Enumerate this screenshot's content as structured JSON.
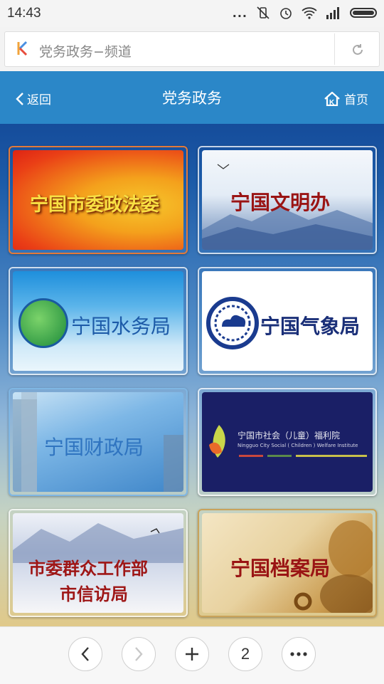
{
  "status_bar": {
    "time": "14:43",
    "dots": "..."
  },
  "address_bar": {
    "title": "党务政务−频道"
  },
  "header": {
    "back_label": "返回",
    "title": "党务政务",
    "home_label": "首页"
  },
  "tiles": [
    {
      "label": "宁国市委政法委"
    },
    {
      "label": "宁国文明办"
    },
    {
      "label": "宁国水务局"
    },
    {
      "label": "宁国气象局"
    },
    {
      "label": "宁国财政局"
    },
    {
      "label": "宁国市社会（儿童）福利院",
      "sub": "Ningguo City Social ( Children ) Welfare Institute"
    },
    {
      "label": "市委群众工作部",
      "label2": "市信访局"
    },
    {
      "label": "宁国档案局"
    }
  ],
  "bottom_nav": {
    "page_count": "2"
  }
}
